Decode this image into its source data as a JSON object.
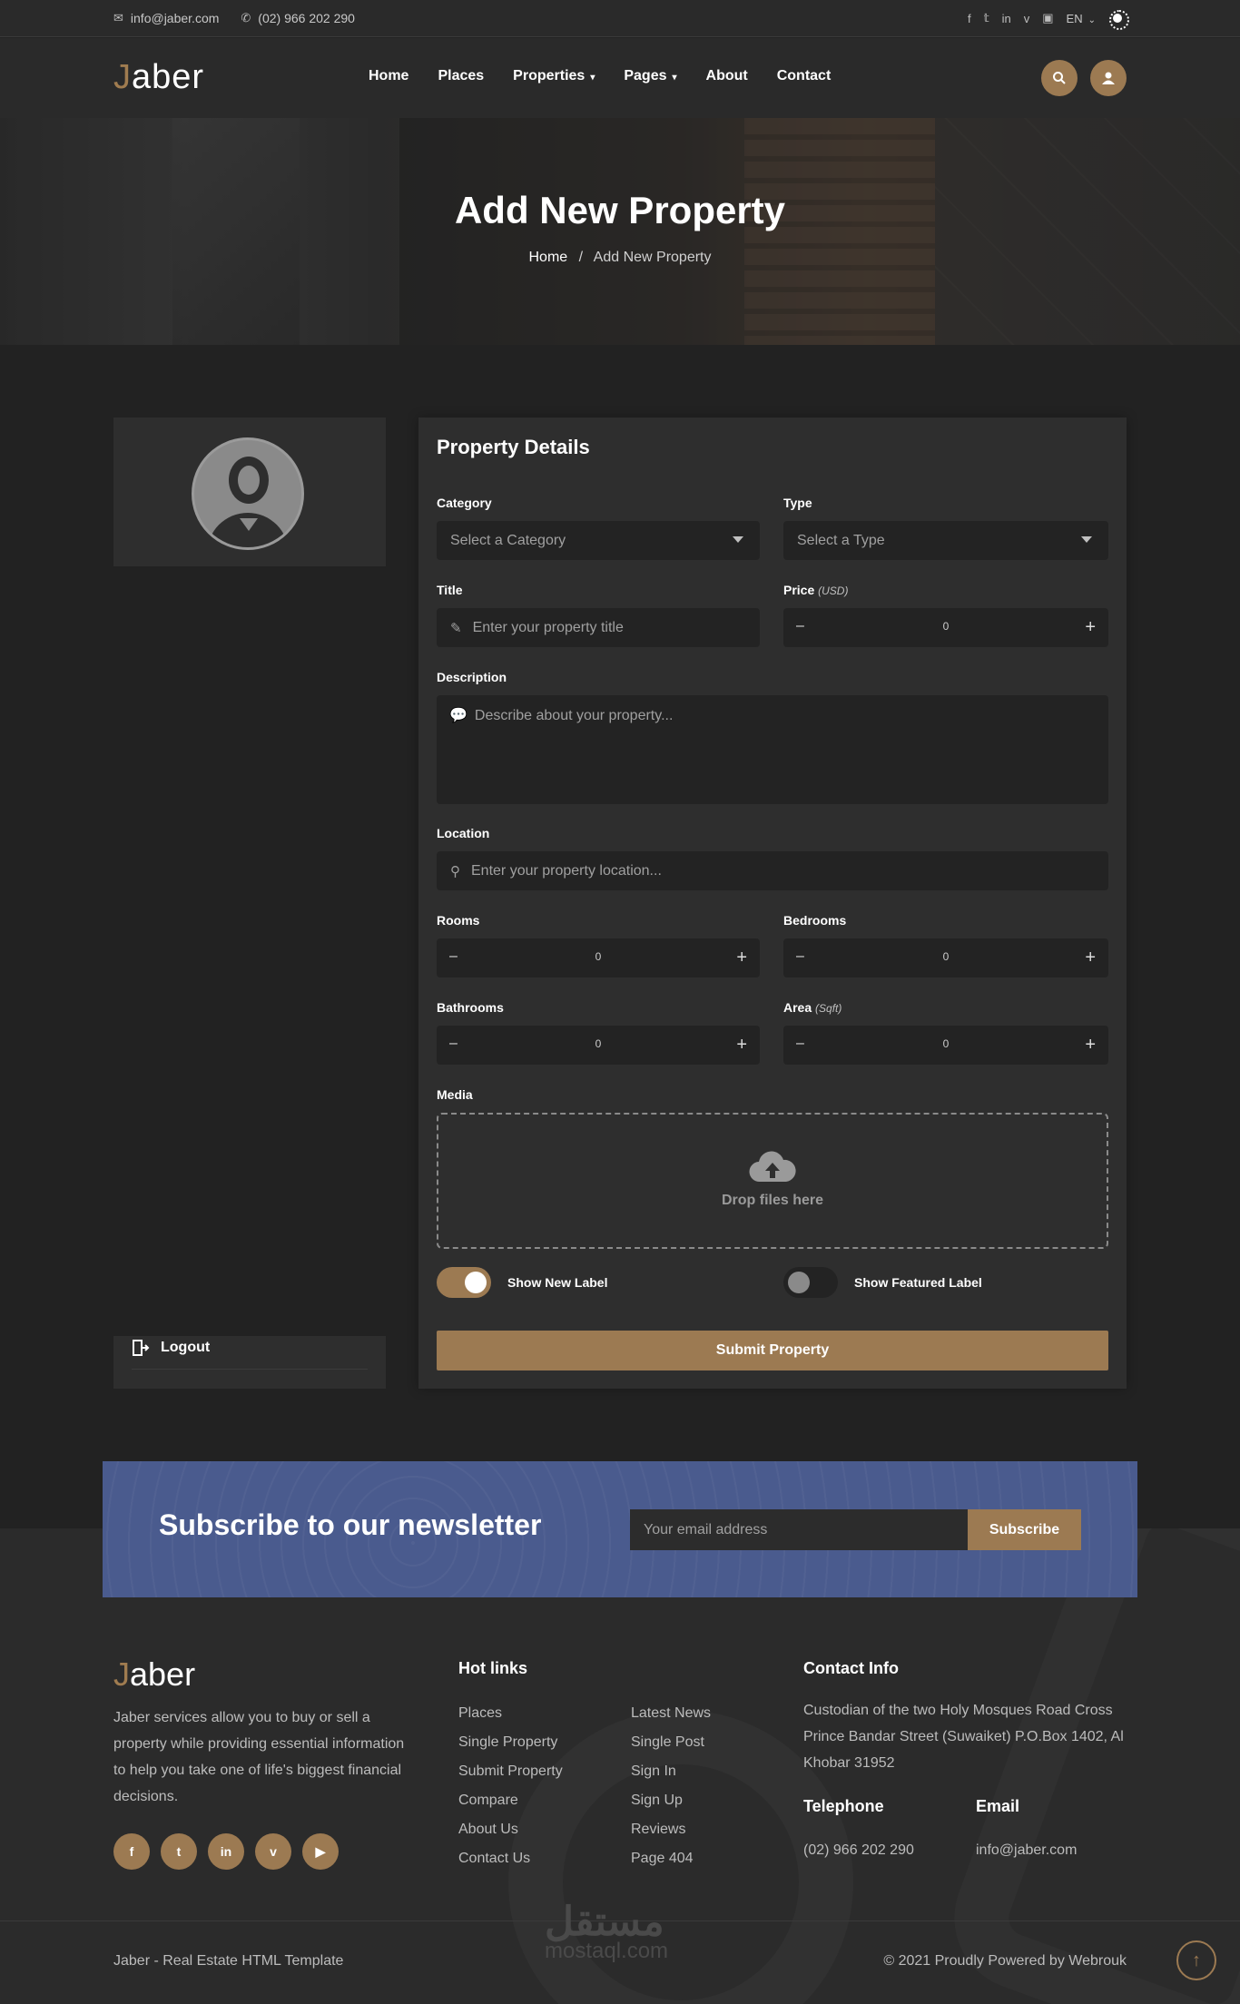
{
  "topbar": {
    "email": "info@jaber.com",
    "phone": "(02) 966 202 290",
    "social_icons": [
      "facebook-icon",
      "twitter-icon",
      "linkedin-icon",
      "vimeo-icon",
      "youtube-icon"
    ],
    "language": "EN"
  },
  "header": {
    "logo_j": "J",
    "logo_rest": "aber",
    "nav": [
      {
        "label": "Home"
      },
      {
        "label": "Places"
      },
      {
        "label": "Properties"
      },
      {
        "label": "Pages"
      },
      {
        "label": "About"
      },
      {
        "label": "Contact"
      }
    ]
  },
  "hero": {
    "title": "Add New Property",
    "breadcrumb_home": "Home",
    "breadcrumb_sep": "/",
    "breadcrumb_current": "Add New Property"
  },
  "sidebar": {
    "logout": "Logout"
  },
  "form": {
    "heading": "Property Details",
    "category_label": "Category",
    "category_value": "Select a Category",
    "type_label": "Type",
    "type_value": "Select a Type",
    "title_label": "Title",
    "title_placeholder": "Enter your property title",
    "price_label": "Price",
    "price_unit": "(USD)",
    "price_value": "0",
    "description_label": "Description",
    "description_placeholder": "Describe about your property...",
    "location_label": "Location",
    "location_placeholder": "Enter your property location...",
    "rooms_label": "Rooms",
    "rooms_value": "0",
    "bedrooms_label": "Bedrooms",
    "bedrooms_value": "0",
    "bathrooms_label": "Bathrooms",
    "bathrooms_value": "0",
    "area_label": "Area",
    "area_unit": "(Sqft)",
    "area_value": "0",
    "media_label": "Media",
    "drop_text": "Drop files here",
    "show_new_label": "Show New Label",
    "show_new_on": true,
    "show_featured_label": "Show Featured Label",
    "show_featured_on": false,
    "submit": "Submit Property",
    "minus": "–",
    "plus": "+"
  },
  "newsletter": {
    "heading": "Subscribe to our newsletter",
    "placeholder": "Your email address",
    "button": "Subscribe"
  },
  "footer": {
    "logo_j": "J",
    "logo_rest": "aber",
    "about": "Jaber services allow you to buy or sell a property while providing essential information to help you take one of life's biggest financial decisions.",
    "social_labels": [
      "f",
      "t",
      "in",
      "v",
      "▶"
    ],
    "hot_links_heading": "Hot links",
    "links_col1": [
      "Places",
      "Single Property",
      "Submit Property",
      "Compare",
      "About Us",
      "Contact Us"
    ],
    "links_col2": [
      "Latest News",
      "Single Post",
      "Sign In",
      "Sign Up",
      "Reviews",
      "Page 404"
    ],
    "contact_heading": "Contact Info",
    "address": "Custodian of the two Holy Mosques Road Cross Prince Bandar Street (Suwaiket) P.O.Box 1402, Al Khobar 31952",
    "telephone_label": "Telephone",
    "telephone": "(02) 966 202 290",
    "email_label": "Email",
    "email": "info@jaber.com",
    "copy_left": "Jaber - Real Estate HTML Template",
    "copy_right": "© 2021 Proudly Powered by Webrouk",
    "watermark": "مستقل",
    "watermark_sub": "mostaql.com"
  },
  "colors": {
    "accent": "#9c7a52",
    "newsletter_bg": "#4a5b8e",
    "page_bg": "#222222",
    "card_bg": "#2e2e2e"
  }
}
